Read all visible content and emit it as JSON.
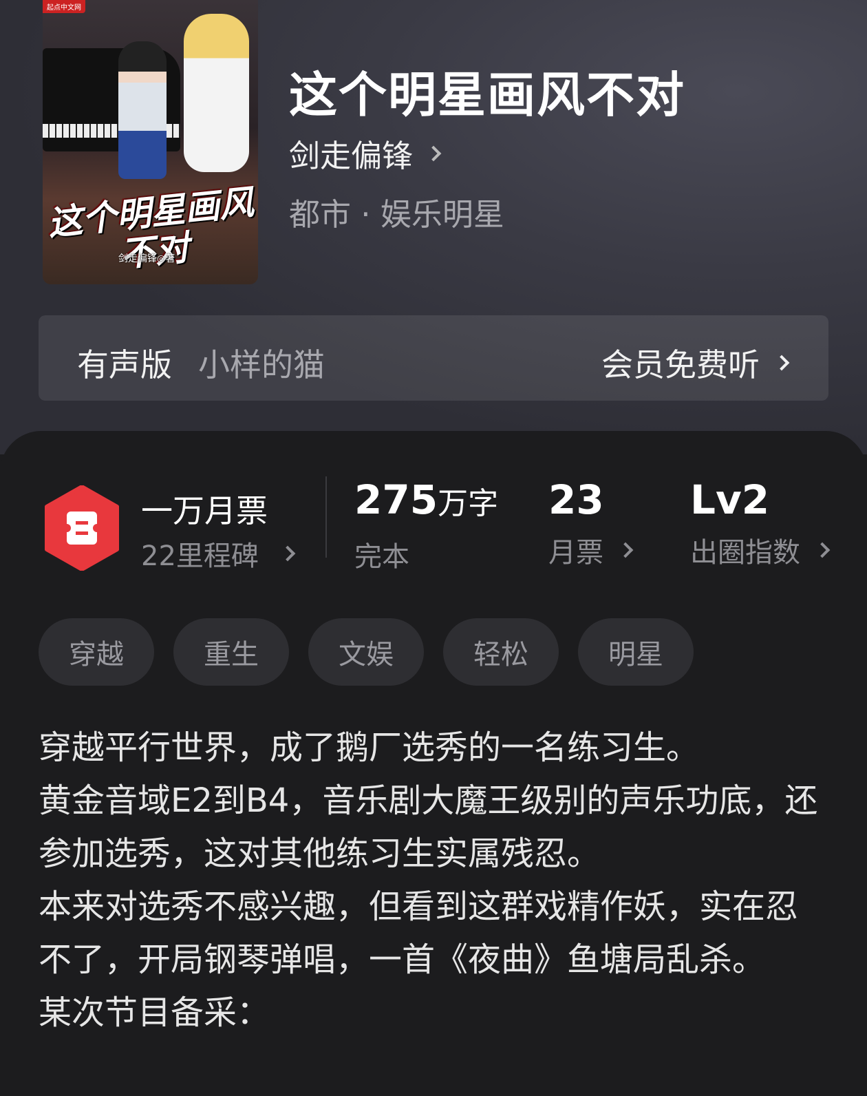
{
  "book": {
    "title": "这个明星画风不对",
    "author": "剑走偏锋",
    "category": "都市 · 娱乐明星",
    "cover": {
      "publisher_mark": "起点中文网",
      "title_art": "这个明星画风不对",
      "author_art": "剑走偏锋◎著"
    }
  },
  "audio": {
    "label": "有声版",
    "narrator": "小样的猫",
    "action": "会员免费听"
  },
  "stats": {
    "award": {
      "title": "一万月票",
      "sub": "22里程碑"
    },
    "words": {
      "value": "275",
      "unit": "万字",
      "label": "完本"
    },
    "votes": {
      "value": "23",
      "label": "月票"
    },
    "level": {
      "value": "Lv2",
      "label": "出圈指数"
    }
  },
  "tags": [
    "穿越",
    "重生",
    "文娱",
    "轻松",
    "明星"
  ],
  "synopsis": [
    "穿越平行世界，成了鹅厂选秀的一名练习生。",
    "黄金音域E2到B4，音乐剧大魔王级别的声乐功底，还参加选秀，这对其他练习生实属残忍。",
    "本来对选秀不感兴趣，但看到这群戏精作妖，实在忍不了，开局钢琴弹唱，一首《夜曲》鱼塘局乱杀。",
    "某次节目备采："
  ],
  "colors": {
    "badge_red": "#e8383d",
    "background": "#1c1c1e",
    "hero": "#3a3a44"
  }
}
